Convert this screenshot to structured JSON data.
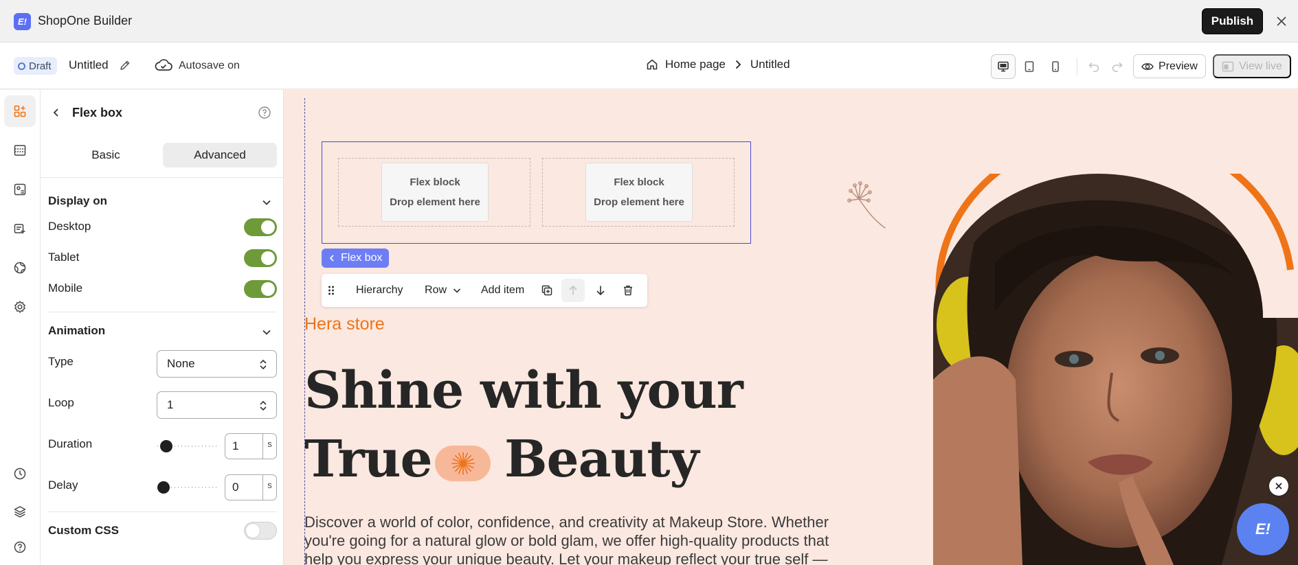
{
  "app": {
    "title": "ShopOne Builder",
    "logo_text": "E!"
  },
  "titlebar": {
    "publish_label": "Publish"
  },
  "toolbar": {
    "status_badge": "Draft",
    "page_name": "Untitled",
    "autosave": "Autosave on",
    "breadcrumb": [
      "Home page",
      "Untitled"
    ],
    "preview_label": "Preview",
    "view_live_label": "View live"
  },
  "panel": {
    "title": "Flex box",
    "tabs": [
      "Basic",
      "Advanced"
    ],
    "active_tab": "Advanced",
    "display_on": {
      "title": "Display on",
      "items": [
        {
          "label": "Desktop",
          "enabled": true
        },
        {
          "label": "Tablet",
          "enabled": true
        },
        {
          "label": "Mobile",
          "enabled": true
        }
      ]
    },
    "animation": {
      "title": "Animation",
      "type_label": "Type",
      "type_value": "None",
      "loop_label": "Loop",
      "loop_value": "1",
      "duration_label": "Duration",
      "duration_value": "1",
      "duration_unit": "s",
      "delay_label": "Delay",
      "delay_value": "0",
      "delay_unit": "s"
    },
    "custom_css": {
      "label": "Custom CSS",
      "enabled": false
    }
  },
  "canvas": {
    "flex_blocks": [
      {
        "title": "Flex block",
        "hint": "Drop element here"
      },
      {
        "title": "Flex block",
        "hint": "Drop element here"
      }
    ],
    "selection_chip": "Flex box",
    "element_toolbar": {
      "hierarchy": "Hierarchy",
      "direction": "Row",
      "add_item": "Add item"
    },
    "store_name": "Hera store",
    "headline_line1": "Shine with your",
    "headline_line2a": "True",
    "headline_line2b": "Beauty",
    "description": "Discover a world of color, confidence, and creativity at Makeup Store. Whether you're going for a natural glow or bold glam, we offer high-quality products that help you express your unique beauty. Let your makeup reflect your true self —",
    "chat_logo": "E!"
  },
  "colors": {
    "accent": "#6d7ef5",
    "toggle_on": "#6e9a39",
    "brand_orange": "#ef7317",
    "canvas_bg": "#fbe8e0"
  }
}
